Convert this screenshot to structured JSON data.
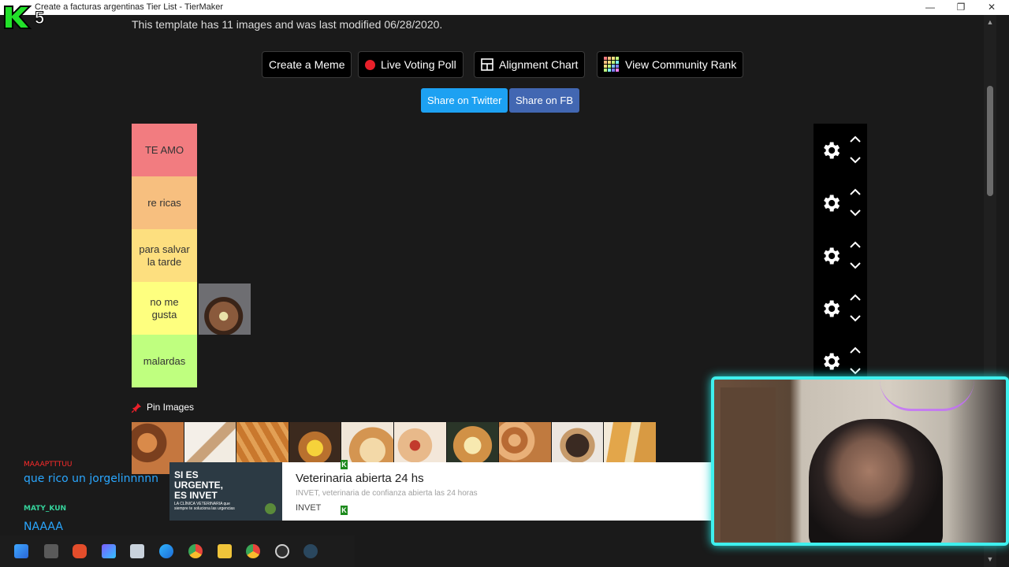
{
  "window": {
    "title": "Create a facturas argentinas Tier List - TierMaker",
    "minimize": "—",
    "maximize": "❐",
    "close": "✕"
  },
  "template_info": "This template has 11 images and was last modified 06/28/2020.",
  "actions": {
    "create_meme": "Create a Meme",
    "live_poll": "Live Voting Poll",
    "alignment_chart": "Alignment Chart",
    "community_rank": "View Community Rank"
  },
  "share": {
    "twitter": "Share on Twitter",
    "fb": "Share on FB"
  },
  "tiers": [
    {
      "label": "TE AMO",
      "color": "#f27c80"
    },
    {
      "label": "re ricas",
      "color": "#f7bf7f"
    },
    {
      "label": "para salvar la tarde",
      "color": "#fddf7f"
    },
    {
      "label": "no me gusta",
      "color": "#feff7f"
    },
    {
      "label": "malardas",
      "color": "#bfff7f"
    }
  ],
  "pin_images": "Pin Images",
  "stream_overlay": {
    "chat": [
      {
        "user": "MAAAPTTTUU",
        "message": "que rico un jorgelinnnnn"
      },
      {
        "user": "MATY_KUN",
        "message": "NAAAA"
      }
    ],
    "ad": {
      "image_text": "SI ES URGENTE, ES INVET",
      "image_subtext": "LA CLÍNICA VETERINARIA que siempre te soluciona las urgencias",
      "headline": "Veterinaria abierta 24 hs",
      "description": "INVET, veterinaria de confianza abierta las 24 horas",
      "brand": "INVET"
    }
  },
  "colors": {
    "background": "#1a1a1a",
    "twitter": "#1da1f2",
    "facebook": "#4267b2",
    "cam_border": "#3ff0ee"
  }
}
